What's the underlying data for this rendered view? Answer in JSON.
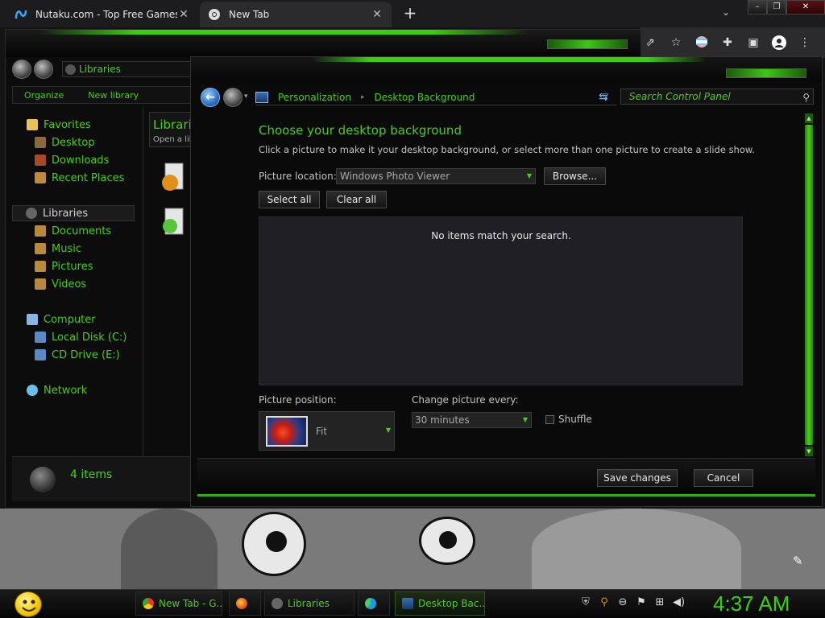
{
  "browser": {
    "tabs": [
      {
        "title": "Nutaku.com - Top Free Games O",
        "active": false
      },
      {
        "title": "New Tab",
        "active": true
      }
    ],
    "new_tab_label": "+",
    "close_glyph": "✕"
  },
  "explorer": {
    "breadcrumb": "Libraries",
    "toolbar": {
      "organize": "Organize",
      "new_library": "New library"
    },
    "nav": {
      "favorites": "Favorites",
      "desktop": "Desktop",
      "downloads": "Downloads",
      "recent_places": "Recent Places",
      "libraries": "Libraries",
      "documents": "Documents",
      "music": "Music",
      "pictures": "Pictures",
      "videos": "Videos",
      "computer": "Computer",
      "local_disk": "Local Disk (C:)",
      "cd_drive": "CD Drive (E:)",
      "network": "Network"
    },
    "library_header": {
      "title": "Librari",
      "subtitle": "Open a lib"
    },
    "status": {
      "item_count": "4 items"
    }
  },
  "control_panel": {
    "breadcrumb": [
      "Personalization",
      "Desktop Background"
    ],
    "search_placeholder": "Search Control Panel",
    "heading": "Choose your desktop background",
    "description": "Click a picture to make it your desktop background, or select more than one picture to create a slide show.",
    "picture_location_label": "Picture location:",
    "picture_location_value": "Windows Photo Viewer",
    "browse_label": "Browse...",
    "select_all_label": "Select all",
    "clear_all_label": "Clear all",
    "empty_message": "No items match your search.",
    "picture_position_label": "Picture position:",
    "picture_position_value": "Fit",
    "change_picture_label": "Change picture every:",
    "change_picture_value": "30 minutes",
    "shuffle_label": "Shuffle",
    "shuffle_checked": false,
    "save_label": "Save changes",
    "cancel_label": "Cancel"
  },
  "taskbar": {
    "tasks": [
      {
        "label": "New Tab - G..."
      },
      {
        "label": ""
      },
      {
        "label": "Libraries"
      },
      {
        "label": ""
      },
      {
        "label": "Desktop Bac..."
      }
    ],
    "clock": "4:37 AM"
  },
  "colors": {
    "accent": "#39d10d",
    "text_green": "#4ccd1a",
    "background": "#0a0a0a"
  }
}
